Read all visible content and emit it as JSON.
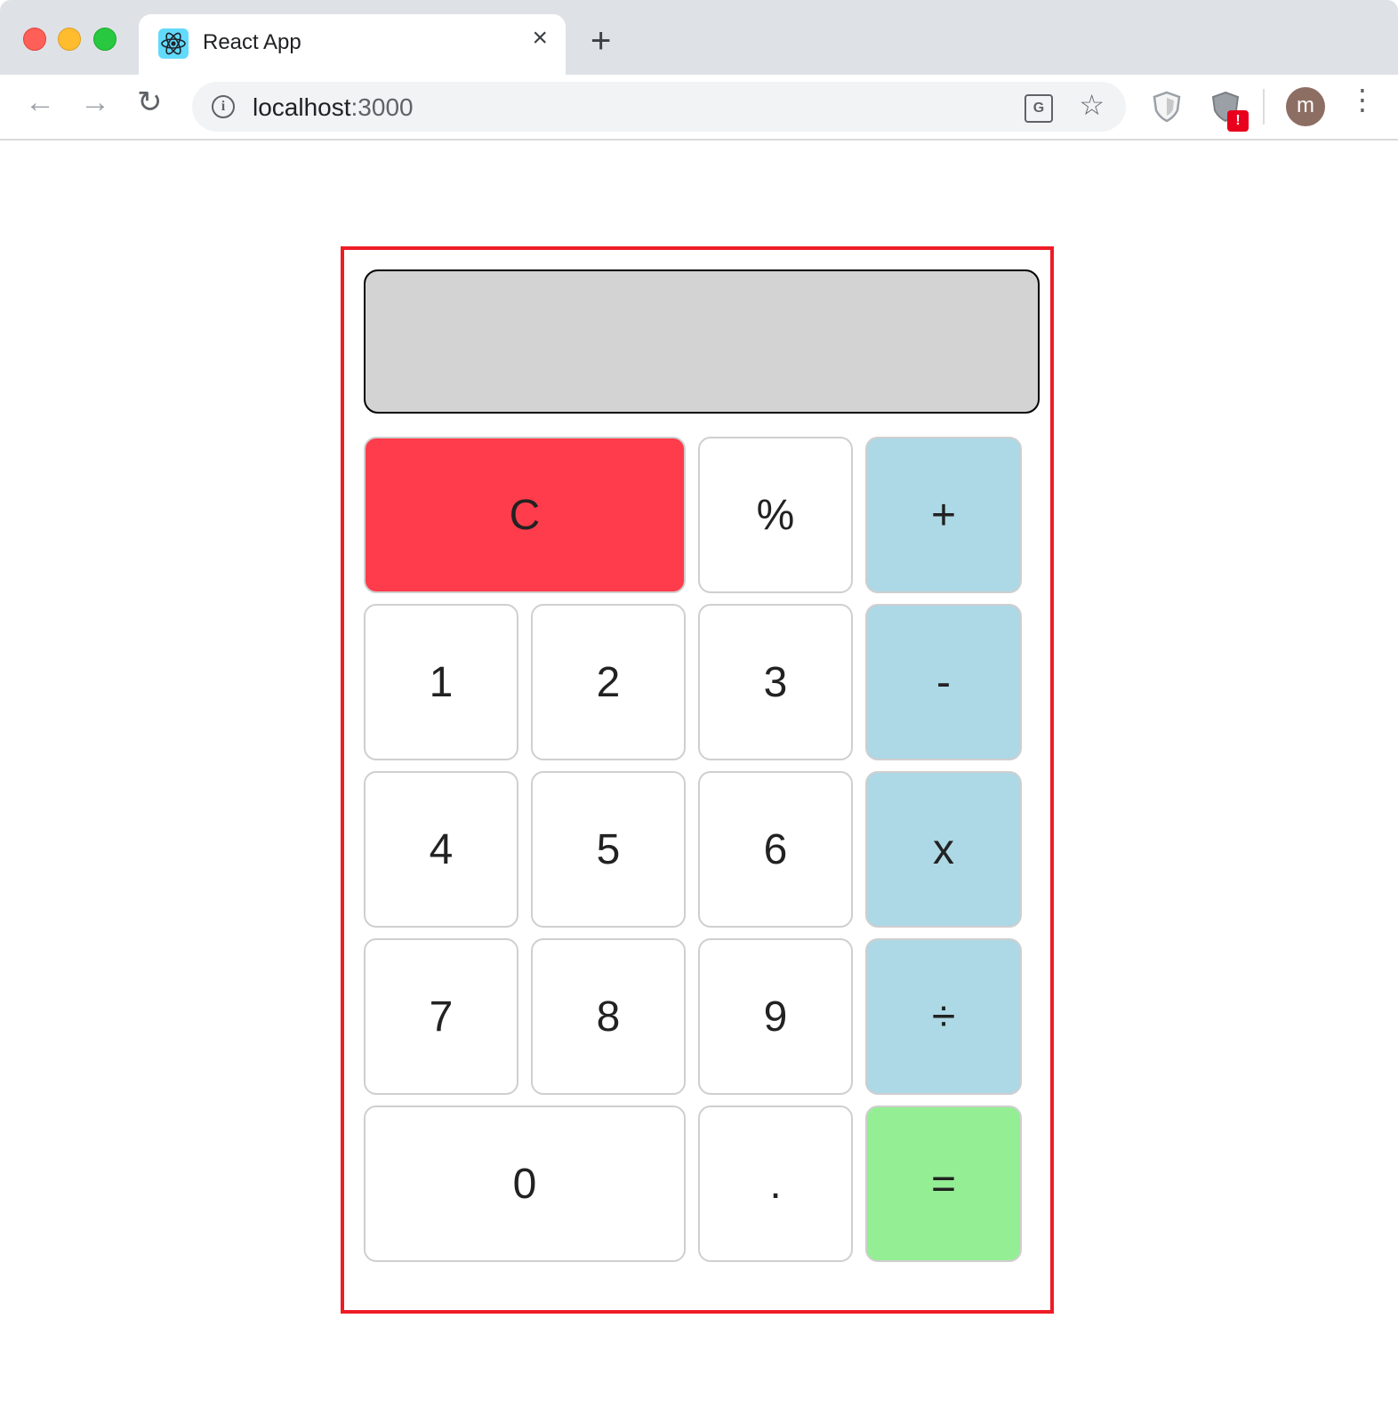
{
  "browser": {
    "tab_title": "React App",
    "tab_close": "×",
    "new_tab": "+",
    "url_host": "localhost",
    "url_port": ":3000",
    "info_glyph": "i",
    "translate_glyph": "G",
    "star_glyph": "☆",
    "ext_badge": "!",
    "avatar_letter": "m",
    "menu_glyph": "⋮",
    "back_glyph": "←",
    "forward_glyph": "→",
    "reload_glyph": "↻",
    "icons": [
      "back-arrow-icon",
      "forward-arrow-icon",
      "reload-icon",
      "info-icon",
      "translate-icon",
      "star-icon",
      "shield-icon",
      "shield-alert-icon",
      "menu-icon",
      "react-logo-icon"
    ]
  },
  "calculator": {
    "display_value": "",
    "keys": {
      "clear": "C",
      "percent": "%",
      "plus": "+",
      "one": "1",
      "two": "2",
      "three": "3",
      "minus": "-",
      "four": "4",
      "five": "5",
      "six": "6",
      "times": "x",
      "seven": "7",
      "eight": "8",
      "nine": "9",
      "divide": "÷",
      "zero": "0",
      "dot": ".",
      "equals": "="
    },
    "colors": {
      "frame_border": "#ee1c25",
      "display_bg": "#d3d3d3",
      "clear_bg": "#ff3c4b",
      "operator_bg": "#add8e6",
      "equals_bg": "#94ee94"
    }
  }
}
